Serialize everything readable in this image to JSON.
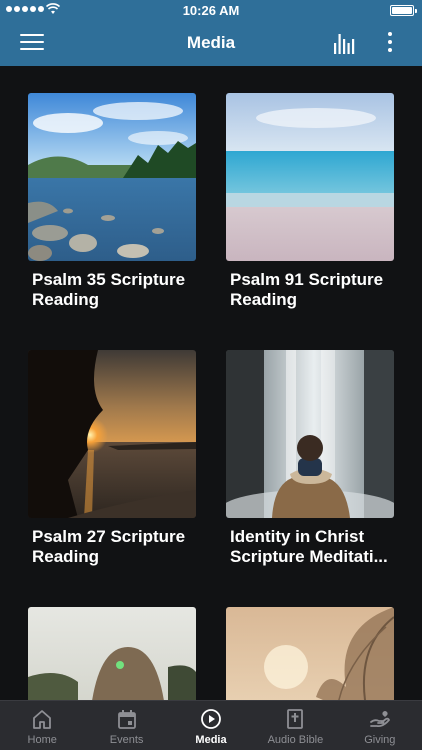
{
  "status_bar": {
    "time": "10:26 AM"
  },
  "app_bar": {
    "title": "Media"
  },
  "media_items": [
    {
      "title": "Psalm 35 Scripture\nReading"
    },
    {
      "title": "Psalm 91 Scripture\nReading"
    },
    {
      "title": "Psalm 27 Scripture\nReading"
    },
    {
      "title": "Identity in Christ\nScripture Meditati..."
    }
  ],
  "tabs": [
    {
      "label": "Home",
      "icon": "home-icon",
      "active": false
    },
    {
      "label": "Events",
      "icon": "calendar-icon",
      "active": false
    },
    {
      "label": "Media",
      "icon": "play-icon",
      "active": true
    },
    {
      "label": "Audio Bible",
      "icon": "bible-icon",
      "active": false
    },
    {
      "label": "Giving",
      "icon": "giving-icon",
      "active": false
    }
  ],
  "colors": {
    "header": "#2f6f99",
    "background": "#111214",
    "tab_bar": "#2b2c30"
  }
}
